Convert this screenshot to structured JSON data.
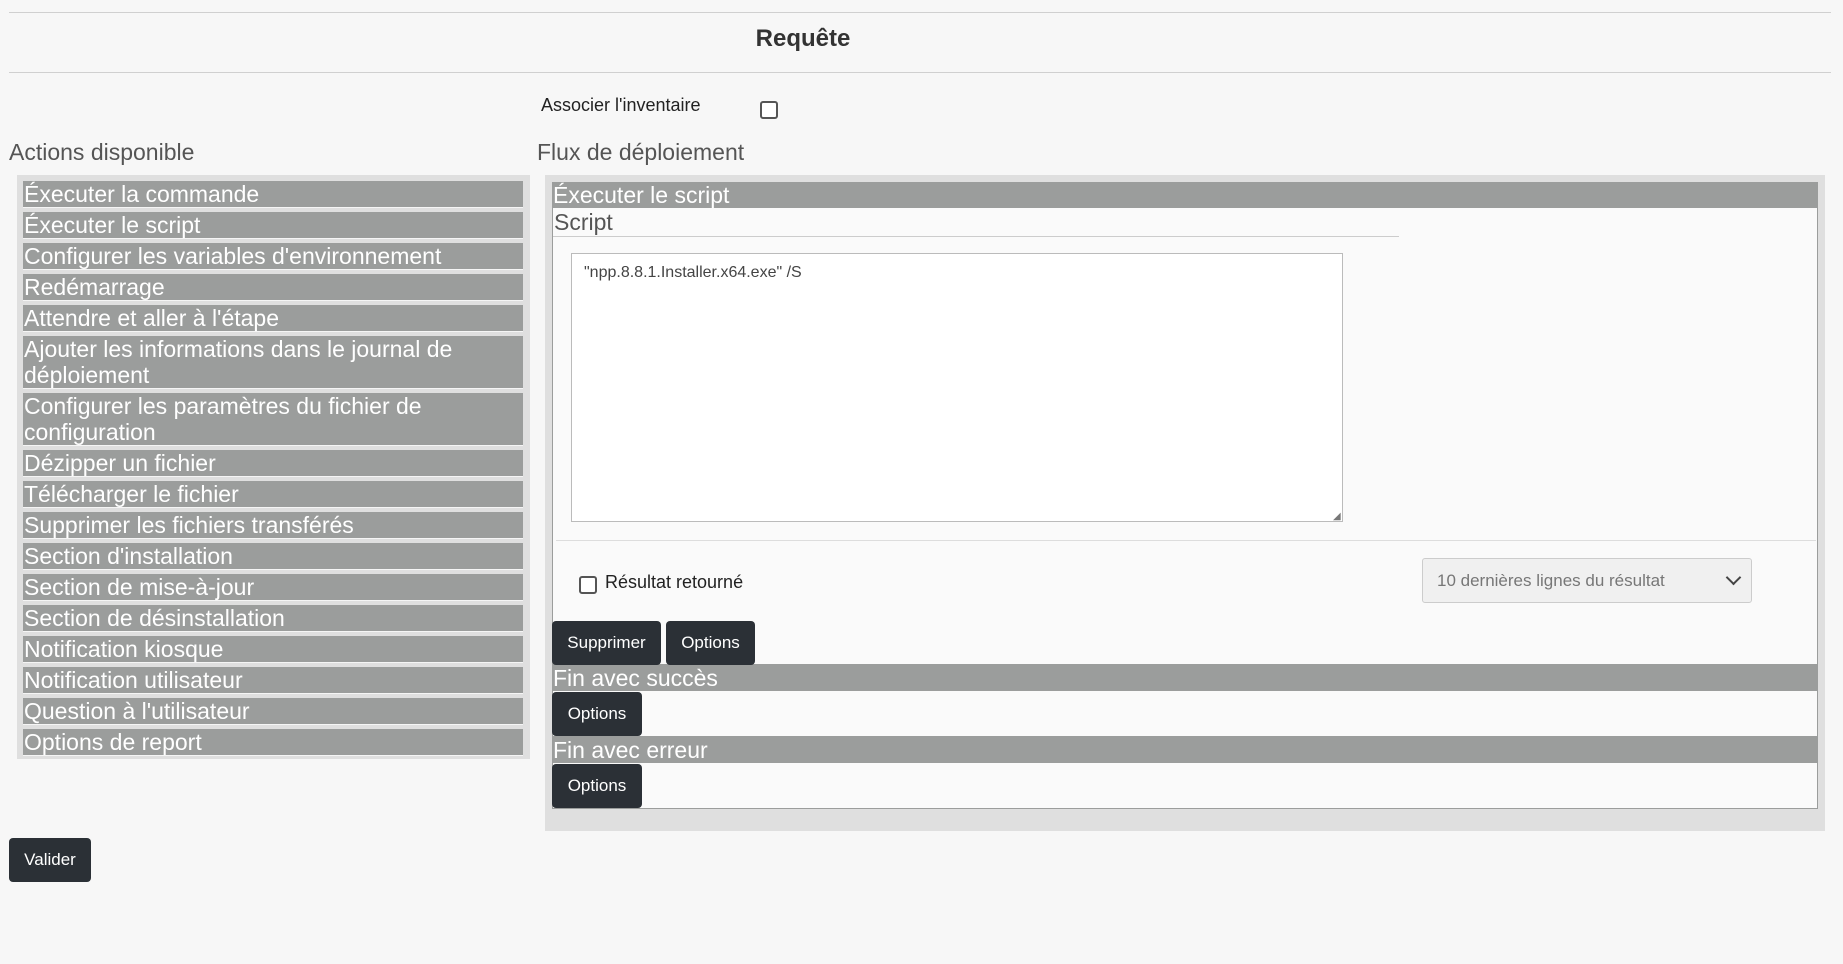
{
  "header": {
    "title": "Requête"
  },
  "associate_inventory": {
    "label": "Associer l'inventaire",
    "checked": false
  },
  "left_column": {
    "title": "Actions disponible",
    "actions": [
      "Éxecuter la commande",
      "Éxecuter le script",
      "Configurer les variables d'environnement",
      "Redémarrage",
      "Attendre et aller à l'étape",
      "Ajouter les informations dans le journal de déploiement",
      "Configurer les paramètres du fichier de configuration",
      "Dézipper un fichier",
      "Télécharger le fichier",
      "Supprimer les fichiers transférés",
      "Section d'installation",
      "Section de mise-à-jour",
      "Section de désinstallation",
      "Notification kiosque",
      "Notification utilisateur",
      "Question à l'utilisateur",
      "Options de report"
    ]
  },
  "right_column": {
    "title": "Flux de déploiement",
    "script_step": {
      "header": "Éxecuter le script",
      "section_title": "Script",
      "script_value": "\"npp.8.8.1.Installer.x64.exe\" /S",
      "result_label": "Résultat retourné",
      "result_checked": false,
      "result_select_value": "10 dernières lignes du résultat",
      "delete_label": "Supprimer",
      "options_label": "Options"
    },
    "success_step": {
      "header": "Fin avec succès",
      "options_label": "Options"
    },
    "error_step": {
      "header": "Fin avec erreur",
      "options_label": "Options"
    }
  },
  "footer": {
    "validate_label": "Valider"
  }
}
